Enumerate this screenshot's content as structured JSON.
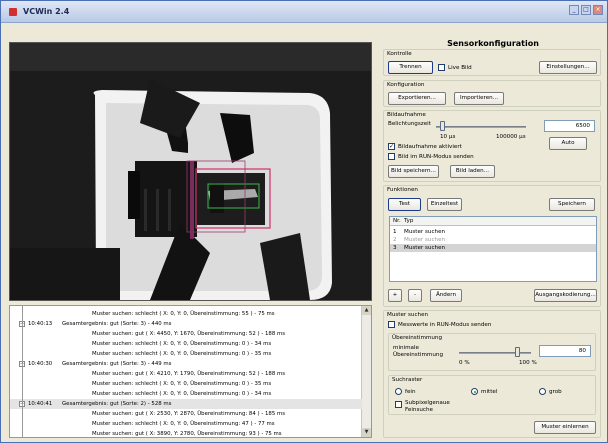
{
  "window": {
    "title": "VCWin 2.4",
    "min": "_",
    "max": "□",
    "close": "×"
  },
  "panel": {
    "title": "Sensorkonfiguration",
    "kontrolle": {
      "label": "Kontrolle",
      "trennen": "Trennen",
      "live_bild": "Live Bild",
      "einstellungen": "Einstellungen..."
    },
    "konfiguration": {
      "label": "Konfiguration",
      "exportieren": "Exportieren...",
      "importieren": "Importieren..."
    },
    "bildaufnahme": {
      "label": "Bildaufnahme",
      "belichtungszeit": "Belichtungszeit",
      "belichtungszeit_value": "6500",
      "min_label": "10 µs",
      "max_label": "100000 µs",
      "slider_fraction": 0.07,
      "auto": "Auto",
      "aktiviert": "Bildaufnahme aktiviert",
      "aktiviert_checked": true,
      "run_modus": "Bild im RUN-Modus senden",
      "run_modus_checked": false,
      "bild_speichern": "Bild speichern...",
      "bild_laden": "Bild laden..."
    },
    "funktionen": {
      "label": "Funktionen",
      "test": "Test",
      "einzeltest": "Einzeltest",
      "speichern": "Speichern",
      "col_nr": "Nr.",
      "col_typ": "Typ",
      "rows": [
        {
          "nr": "1",
          "typ": "Muster suchen",
          "state": "normal"
        },
        {
          "nr": "2",
          "typ": "Muster suchen",
          "state": "disabled"
        },
        {
          "nr": "3",
          "typ": "Muster suchen",
          "state": "selected"
        }
      ],
      "add": "+",
      "remove": "-",
      "aendern": "Ändern",
      "ausgangskodierung": "Ausgangskodierung..."
    },
    "muster": {
      "label": "Muster suchen",
      "messwerte": "Messwerte in RUN-Modus senden",
      "messwerte_checked": false,
      "uebereinstimmung_label": "Übereinstimmung",
      "minimale": "minimale",
      "minimale2": "Übereinstimmung",
      "value": "80",
      "slider_fraction": 0.8,
      "pct_min": "0 %",
      "pct_max": "100 %",
      "suchraster": "Suchraster",
      "fein": "fein",
      "mittel": "mittel",
      "grob": "grob",
      "selected_raster": "mittel",
      "subpixel1": "Subpixelgenaue",
      "subpixel2": "Feinsuche",
      "subpixel_checked": false,
      "einlernen": "Muster einlernen"
    }
  },
  "log": {
    "rows": [
      {
        "time": "",
        "msg": "Muster suchen: schlecht ( X: 0, Y: 0, Übereinstimmung: 55 ) - 75 ms",
        "indent": 2,
        "selected": false
      },
      {
        "time": "10:40:13",
        "msg": "Gesamtergebnis: gut (Sorte: 3) - 440 ms",
        "indent": 1,
        "selected": false
      },
      {
        "time": "",
        "msg": "Muster suchen: gut ( X: 4450, Y: 1670, Übereinstimmung: 52 ) - 188 ms",
        "indent": 2,
        "selected": false
      },
      {
        "time": "",
        "msg": "Muster suchen: schlecht ( X: 0, Y: 0, Übereinstimmung: 0 ) - 34 ms",
        "indent": 2,
        "selected": false
      },
      {
        "time": "",
        "msg": "Muster suchen: schlecht ( X: 0, Y: 0, Übereinstimmung: 0 ) - 35 ms",
        "indent": 2,
        "selected": false
      },
      {
        "time": "10:40:30",
        "msg": "Gesamtergebnis: gut (Sorte: 3) - 449 ms",
        "indent": 1,
        "selected": false
      },
      {
        "time": "",
        "msg": "Muster suchen: gut ( X: 4210, Y: 1790, Übereinstimmung: 52 ) - 188 ms",
        "indent": 2,
        "selected": false
      },
      {
        "time": "",
        "msg": "Muster suchen: schlecht ( X: 0, Y: 0, Übereinstimmung: 0 ) - 35 ms",
        "indent": 2,
        "selected": false
      },
      {
        "time": "",
        "msg": "Muster suchen: schlecht ( X: 0, Y: 0, Übereinstimmung: 0 ) - 34 ms",
        "indent": 2,
        "selected": false
      },
      {
        "time": "10:40:41",
        "msg": "Gesamtergebnis: gut (Sorte: 2) - 528 ms",
        "indent": 1,
        "selected": true
      },
      {
        "time": "",
        "msg": "Muster suchen: gut ( X: 2530, Y: 2870, Übereinstimmung: 84 ) - 185 ms",
        "indent": 2,
        "selected": false
      },
      {
        "time": "",
        "msg": "Muster suchen: schlecht ( X: 0, Y: 0, Übereinstimmung: 47 ) - 77 ms",
        "indent": 2,
        "selected": false
      },
      {
        "time": "",
        "msg": "Muster suchen: gut ( X: 3890, Y: 2780, Übereinstimmung: 93 ) - 75 ms",
        "indent": 2,
        "selected": false
      }
    ]
  },
  "colors": {
    "roi_outer": "#d0306a",
    "roi_inner": "#3bb54a",
    "title_bg": "#b9c9e6"
  }
}
